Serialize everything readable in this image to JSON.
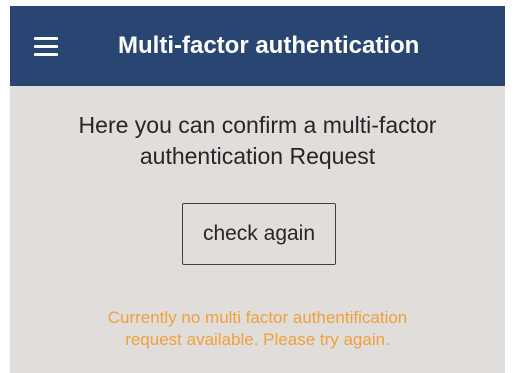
{
  "header": {
    "menu_icon": "hamburger-menu-icon",
    "title": "Multi-factor authentication",
    "background_color": "#294673",
    "text_color": "#ffffff"
  },
  "main": {
    "description_line1": "Here you can confirm a multi-factor",
    "description_line2": "authentication Request",
    "check_button_label": "check again",
    "status_line1": "Currently no multi factor authentification",
    "status_line2": "request available. Please try again.",
    "status_color": "#f0a13c",
    "background_color": "#e0dddb"
  }
}
